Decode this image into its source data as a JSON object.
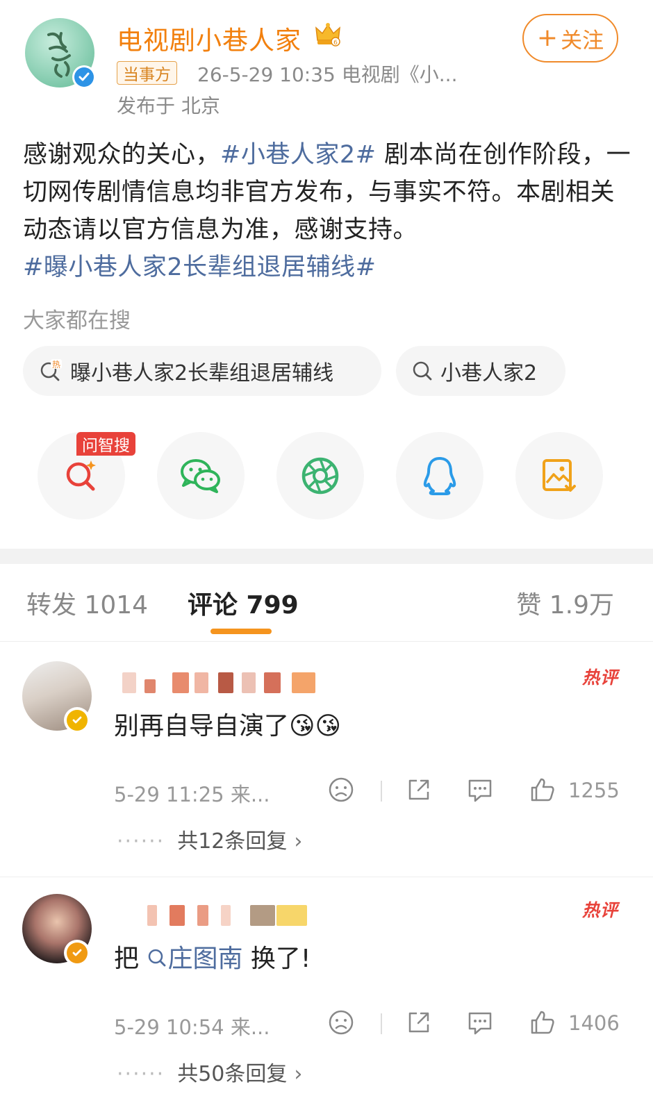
{
  "post": {
    "author": "电视剧小巷人家",
    "follow_label": "关注",
    "party_badge": "当事方",
    "meta": "26-5-29 10:35  电视剧《小...",
    "location": "发布于 北京",
    "body_1": "感谢观众的关心，",
    "hashtag_1": "#小巷人家2#",
    "body_2": " 剧本尚在创作阶段，一切网传剧情信息均非官方发布，与事实不符。本剧相关动态请以官方信息为准，感谢支持。",
    "hashtag_2": "#曝小巷人家2长辈组退居辅线#",
    "search_title": "大家都在搜",
    "search_chips": [
      {
        "label": "曝小巷人家2长辈组退居辅线",
        "icon": "hot-search-icon"
      },
      {
        "label": "小巷人家2",
        "icon": "search-icon"
      }
    ],
    "ask_tag": "问智搜",
    "share_icons": [
      "ai-search-icon",
      "wechat-icon",
      "moments-icon",
      "qq-icon",
      "save-image-icon"
    ]
  },
  "tabs": {
    "repost": "转发 1014",
    "comment": "评论 799",
    "like": "赞 1.9万"
  },
  "comments": [
    {
      "hot_tag": "热评",
      "text": "别再自导自演了",
      "emoji": "😘😘",
      "time": "5-29 11:25 来...",
      "likes": "1255",
      "replies_prefix": "共12条回复",
      "dots": "······"
    },
    {
      "hot_tag": "热评",
      "text_before": "把",
      "link": "庄图南",
      "text_after": " 换了!",
      "time": "5-29 10:54 来...",
      "likes": "1406",
      "replies_prefix": "共50条回复",
      "dots": "······"
    }
  ],
  "colors": {
    "accent_orange": "#f2800e",
    "link_blue": "#4e6c9e",
    "hot_red": "#e8423a",
    "tab_underline": "#f5941e"
  }
}
